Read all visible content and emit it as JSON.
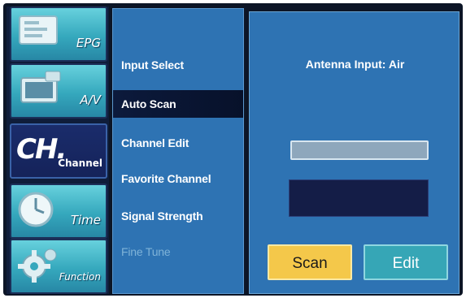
{
  "categories": [
    {
      "label": "EPG",
      "icon": "epg-icon"
    },
    {
      "label": "A/V",
      "icon": "av-icon"
    },
    {
      "label": "Channel",
      "big": "CH.",
      "icon": "channel-icon",
      "active": true
    },
    {
      "label": "Time",
      "icon": "clock-icon"
    },
    {
      "label": "Function",
      "icon": "gear-icon"
    }
  ],
  "menu": {
    "items": [
      {
        "label": "Input Select"
      },
      {
        "label": "Auto Scan",
        "selected": true
      },
      {
        "label": "Channel Edit"
      },
      {
        "label": "Favorite Channel"
      },
      {
        "label": "Signal Strength"
      },
      {
        "label": "Fine Tune",
        "disabled": true
      }
    ]
  },
  "panel": {
    "antenna_text": "Antenna Input: Air",
    "scan_label": "Scan",
    "edit_label": "Edit"
  },
  "colors": {
    "menu_blue": "#2e73b3",
    "category_cyan": "#35a8bd",
    "scan_yellow": "#f4c84a",
    "edit_teal": "#36a6b6"
  }
}
